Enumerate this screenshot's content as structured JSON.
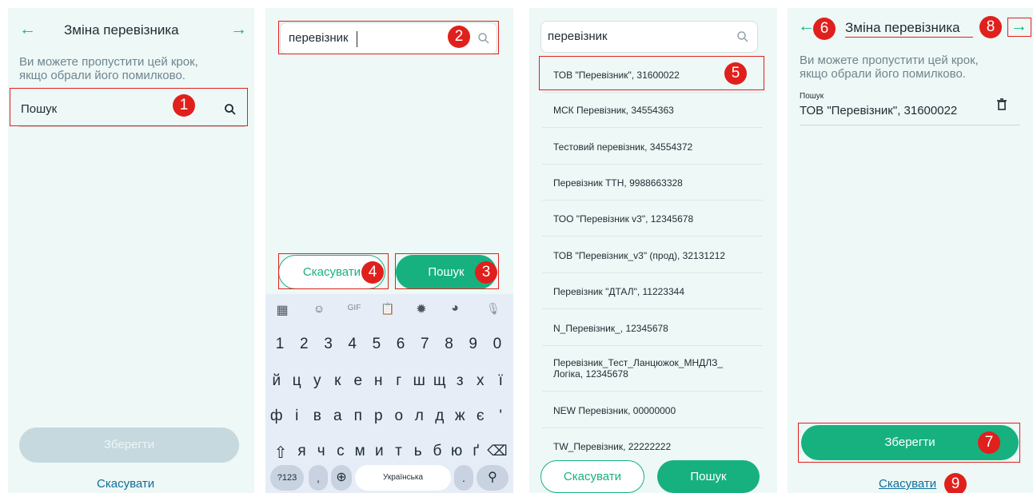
{
  "panel1": {
    "back_arrow": "←",
    "title": "Зміна перевізника",
    "forward_arrow": "→",
    "hint_line1": "Ви можете пропустити цей крок,",
    "hint_line2": "якщо обрали його помилково.",
    "search_placeholder": "Пошук",
    "save_label": "Зберегти",
    "cancel_label": "Скасувати"
  },
  "panel2": {
    "search_value": "перевізник",
    "cancel_label": "Скасувати",
    "search_label": "Пошук",
    "keyboard": {
      "toolbar": [
        "apps-icon",
        "sticker-icon",
        "gif-icon",
        "clipboard-icon",
        "settings-icon",
        "palette-icon",
        "mic-icon"
      ],
      "gif_label": "GIF",
      "row_numbers": [
        "1",
        "2",
        "3",
        "4",
        "5",
        "6",
        "7",
        "8",
        "9",
        "0"
      ],
      "row1": [
        "й",
        "ц",
        "у",
        "к",
        "е",
        "н",
        "г",
        "ш",
        "щ",
        "з",
        "х",
        "ї"
      ],
      "row2": [
        "ф",
        "і",
        "в",
        "а",
        "п",
        "р",
        "о",
        "л",
        "д",
        "ж",
        "є",
        "'"
      ],
      "row3": [
        "я",
        "ч",
        "с",
        "м",
        "и",
        "т",
        "ь",
        "б",
        "ю",
        "ґ"
      ],
      "shift": "⇧",
      "backspace": "⌫",
      "mode_label": "?123",
      "comma": ",",
      "globe": "⊕",
      "space_label": "Українська",
      "period": ".",
      "search_key": "⚲"
    }
  },
  "panel3": {
    "search_value": "перевізник",
    "items": [
      "ТОВ \"Перевізник\", 31600022",
      "МСК Перевізник, 34554363",
      "Тестовий перевізник, 34554372",
      "Перевізник ТТН, 9988663328",
      "ТОО \"Перевізник v3\", 12345678",
      "ТОВ \"Перевізник_v3\" (прод), 32131212",
      "Перевізник \"ДТАЛ\", 11223344",
      "N_Перевізник_, 12345678",
      "Перевізник_Тест_Ланцюжок_МНДЛЗ_",
      "NEW Перевізник, 00000000",
      "TW_Перевізник, 22222222"
    ],
    "item9_line2": "Логіка, 12345678",
    "cancel_label": "Скасувати",
    "search_label": "Пошук"
  },
  "panel4": {
    "back_arrow": "←",
    "title": "Зміна перевізника",
    "forward_arrow": "→",
    "hint_line1": "Ви можете пропустити цей крок,",
    "hint_line2": "якщо обрали його помилково.",
    "field_label": "Пошук",
    "field_value": "ТОВ \"Перевізник\", 31600022",
    "save_label": "Зберегти",
    "cancel_label": "Скасувати"
  },
  "badges": [
    "1",
    "2",
    "3",
    "4",
    "5",
    "6",
    "7",
    "8",
    "9"
  ],
  "colors": {
    "accent": "#17b17f",
    "panel_bg": "#eef8f6",
    "annotation_red": "#e0201c",
    "link": "#0f6e9a"
  }
}
